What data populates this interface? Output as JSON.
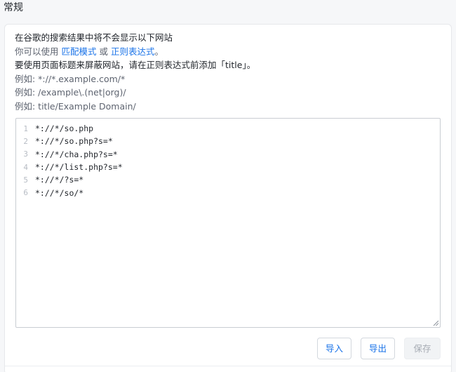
{
  "section": {
    "title": "常规"
  },
  "description": {
    "line1": "在谷歌的搜索结果中将不会显示以下网站",
    "line2_prefix": "你可以使用 ",
    "line2_link1": "匹配模式",
    "line2_mid": " 或 ",
    "line2_link2": "正则表达式",
    "line2_suffix": "。",
    "line3": "要使用页面标题来屏蔽网站，请在正则表达式前添加「title」。",
    "example1": "例如: *://*.example.com/*",
    "example2": "例如: /example\\.(net|org)/",
    "example3": "例如: title/Example Domain/"
  },
  "editor": {
    "lines": [
      {
        "num": "1",
        "text": "*://*/so.php"
      },
      {
        "num": "2",
        "text": "*://*/so.php?s=*"
      },
      {
        "num": "3",
        "text": "*://*/cha.php?s=*"
      },
      {
        "num": "4",
        "text": "*://*/list.php?s=*"
      },
      {
        "num": "5",
        "text": "*://*/?s=*"
      },
      {
        "num": "6",
        "text": "*://*/so/*"
      }
    ]
  },
  "buttons": {
    "import": "导入",
    "export": "导出",
    "save": "保存"
  }
}
